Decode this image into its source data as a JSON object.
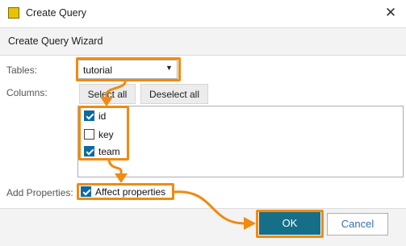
{
  "window": {
    "title": "Create Query",
    "close_glyph": "✕",
    "app_icon": "query-app-icon"
  },
  "wizard": {
    "title": "Create Query Wizard"
  },
  "form": {
    "tables_label": "Tables:",
    "tables_value": "tutorial",
    "columns_label": "Columns:",
    "select_all": "Select all",
    "deselect_all": "Deselect all",
    "columns": [
      {
        "label": "id",
        "checked": true
      },
      {
        "label": "key",
        "checked": false
      },
      {
        "label": "team",
        "checked": true
      }
    ],
    "add_properties_label": "Add Properties:",
    "affect_properties": {
      "label": "Affect properties",
      "checked": true
    }
  },
  "footer": {
    "ok": "OK",
    "cancel": "Cancel"
  },
  "colors": {
    "accent": "#f08a10",
    "checkbox": "#0b6aa5",
    "ok_button": "#156f89"
  }
}
